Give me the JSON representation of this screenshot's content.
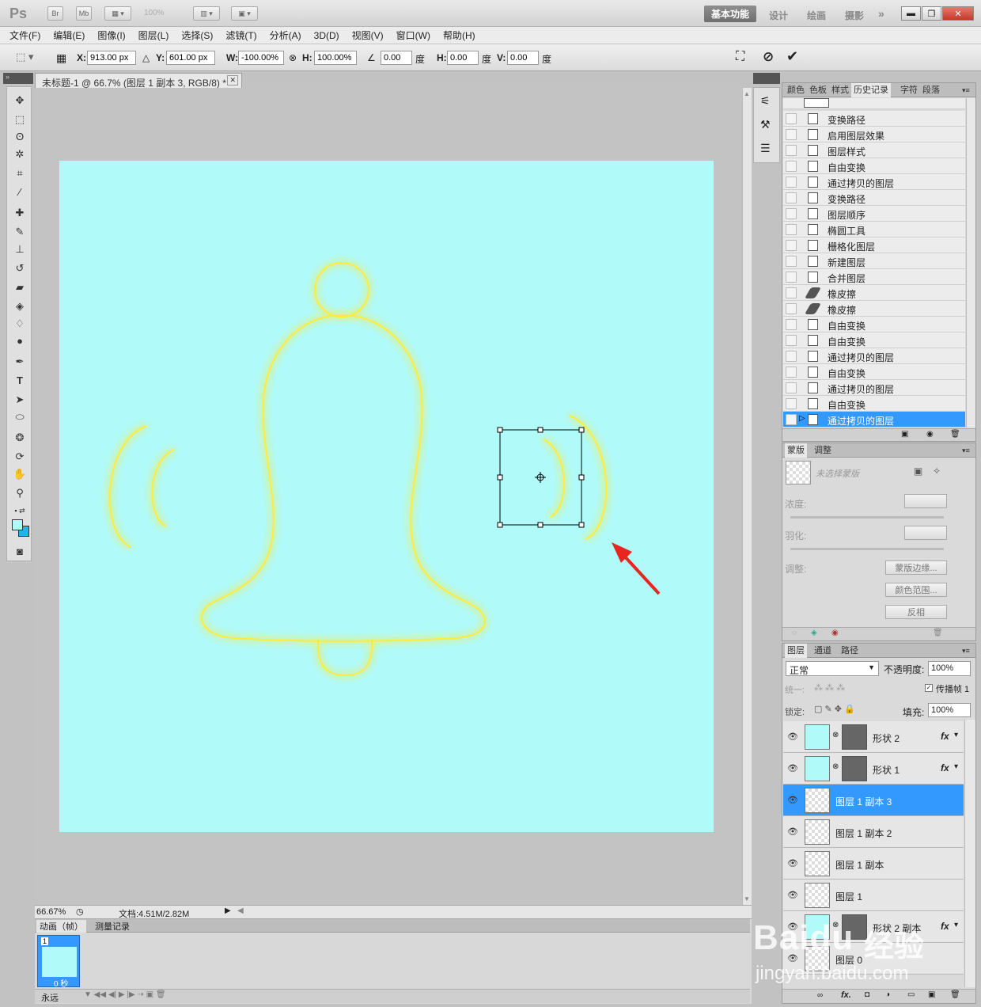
{
  "app": {
    "logo": "Ps",
    "bridge": "Br",
    "minibridge": "Mb",
    "zoom": "100%"
  },
  "workspace": {
    "active": "基本功能",
    "others": [
      "设计",
      "绘画",
      "摄影"
    ]
  },
  "window_buttons": {
    "minimize": "▬",
    "restore": "❐",
    "close": "✕"
  },
  "menu": [
    "文件(F)",
    "编辑(E)",
    "图像(I)",
    "图层(L)",
    "选择(S)",
    "滤镜(T)",
    "分析(A)",
    "3D(D)",
    "视图(V)",
    "窗口(W)",
    "帮助(H)"
  ],
  "options": {
    "x_label": "X:",
    "x": "913.00 px",
    "y_label": "Y:",
    "y": "601.00 px",
    "w_label": "W:",
    "w": "-100.00%",
    "h_label": "H:",
    "h": "100.00%",
    "angle": "0.00",
    "angle_unit": "度",
    "hskew_label": "H:",
    "hskew": "0.00",
    "hskew_unit": "度",
    "vskew_label": "V:",
    "vskew": "0.00",
    "vskew_unit": "度"
  },
  "document": {
    "tab": "未标题-1 @ 66.7% (图层 1 副本 3, RGB/8) *",
    "close": "✕",
    "zoom": "66.67%",
    "docinfo": "文档:4.51M/2.82M"
  },
  "animation": {
    "tabs": [
      "动画（帧）",
      "测量记录"
    ],
    "frame_number": "1",
    "frame_time": "0 秒",
    "loop": "永远"
  },
  "history": {
    "tabs": [
      "颜色",
      "色板",
      "样式",
      "历史记录",
      "字符",
      "段落"
    ],
    "items": [
      "变换路径",
      "启用图层效果",
      "图层样式",
      "自由变换",
      "通过拷贝的图层",
      "变换路径",
      "图层顺序",
      "椭圆工具",
      "栅格化图层",
      "新建图层",
      "合并图层",
      "橡皮擦",
      "橡皮擦",
      "自由变换",
      "自由变换",
      "通过拷贝的图层",
      "自由变换",
      "通过拷贝的图层",
      "自由变换",
      "通过拷贝的图层"
    ],
    "selected_index": 19
  },
  "masks": {
    "tabs": [
      "蒙版",
      "调整"
    ],
    "no_mask": "未选择蒙版",
    "density": "浓度:",
    "feather": "羽化:",
    "refine": "调整:",
    "buttons": [
      "蒙版边缘...",
      "颜色范围...",
      "反相"
    ]
  },
  "layers": {
    "tabs": [
      "图层",
      "通道",
      "路径"
    ],
    "blend_mode": "正常",
    "opacity_label": "不透明度:",
    "opacity": "100%",
    "unify_label": "统一:",
    "propagate_label": "传播帧 1",
    "lock_label": "锁定:",
    "fill_label": "填充:",
    "fill": "100%",
    "items": [
      {
        "name": "形状 2",
        "type": "shape",
        "fx": "fx"
      },
      {
        "name": "形状 1",
        "type": "shape",
        "fx": "fx"
      },
      {
        "name": "图层 1 副本 3",
        "type": "pixel",
        "selected": true
      },
      {
        "name": "图层 1 副本 2",
        "type": "pixel"
      },
      {
        "name": "图层 1 副本",
        "type": "pixel"
      },
      {
        "name": "图层 1",
        "type": "pixel"
      },
      {
        "name": "形状 2 副本",
        "type": "shape",
        "fx": "fx"
      },
      {
        "name": "图层 0",
        "type": "pixel"
      }
    ]
  },
  "watermark": {
    "brand": "Baidu",
    "product": "经验",
    "url": "jingyan.baidu.com"
  },
  "colors": {
    "canvas": "#b0fafa",
    "glow": "#ffeb3b",
    "selection": "#3399ff",
    "arrow": "#e8251e"
  }
}
